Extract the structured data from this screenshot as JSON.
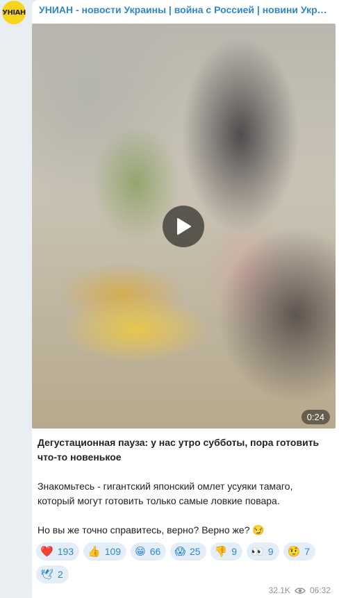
{
  "channel": {
    "name": "УНИАН - новости Украины | война с Россией | новини України",
    "avatar_text": "УНІАН"
  },
  "video": {
    "duration": "0:24"
  },
  "post": {
    "title": "Дегустационная пауза: у нас утро субботы, пора готовить что-то новенькое",
    "paragraph1": "Знакомьтесь - гигантский японский омлет усуяки тамаго, который могут готовить только самые ловкие повара.",
    "paragraph2": "Но вы же точно справитесь, верно? Верно же? 😏"
  },
  "reactions": [
    {
      "emoji": "❤️",
      "count": "193"
    },
    {
      "emoji": "👍",
      "count": "109"
    },
    {
      "emoji": "😁",
      "count": "66"
    },
    {
      "emoji": "😱",
      "count": "25"
    },
    {
      "emoji": "👎",
      "count": "9"
    },
    {
      "emoji": "👀",
      "count": "9"
    },
    {
      "emoji": "🤨",
      "count": "7"
    },
    {
      "emoji": "🕊",
      "count": "2"
    }
  ],
  "meta": {
    "views": "32.1K",
    "time": "06:32"
  }
}
